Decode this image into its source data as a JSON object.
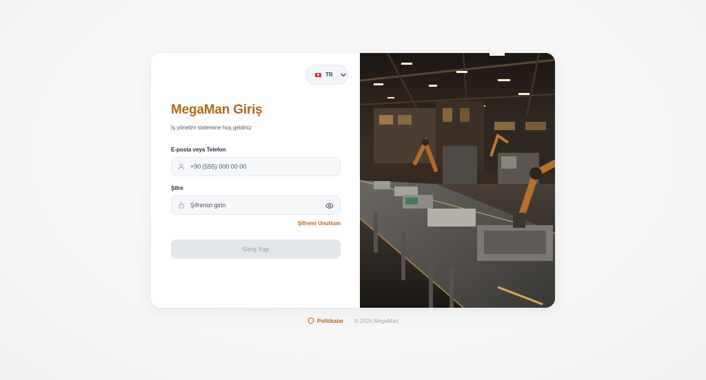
{
  "language": {
    "code": "TR"
  },
  "login": {
    "title": "MegaMan Giriş",
    "subtitle": "İş yönetim sistemine hoş geldiniz",
    "email_label": "E-posta veya Telefon",
    "email_placeholder": "+90 (555) 000 00 00",
    "password_label": "Şifre",
    "password_placeholder": "Şifrenizi girin",
    "forgot_label": "Şifremi Unuttum",
    "submit_label": "Giriş Yap"
  },
  "footer": {
    "policies_label": "Politikalar",
    "copyright": "© 2026 MegaMan"
  },
  "colors": {
    "accent": "#b8651a",
    "flag": "#d6283a",
    "button_disabled": "#e3e7ec"
  },
  "icons": [
    "flag-icon",
    "chevron-down-icon",
    "user-icon",
    "lock-icon",
    "eye-icon",
    "shield-icon"
  ]
}
